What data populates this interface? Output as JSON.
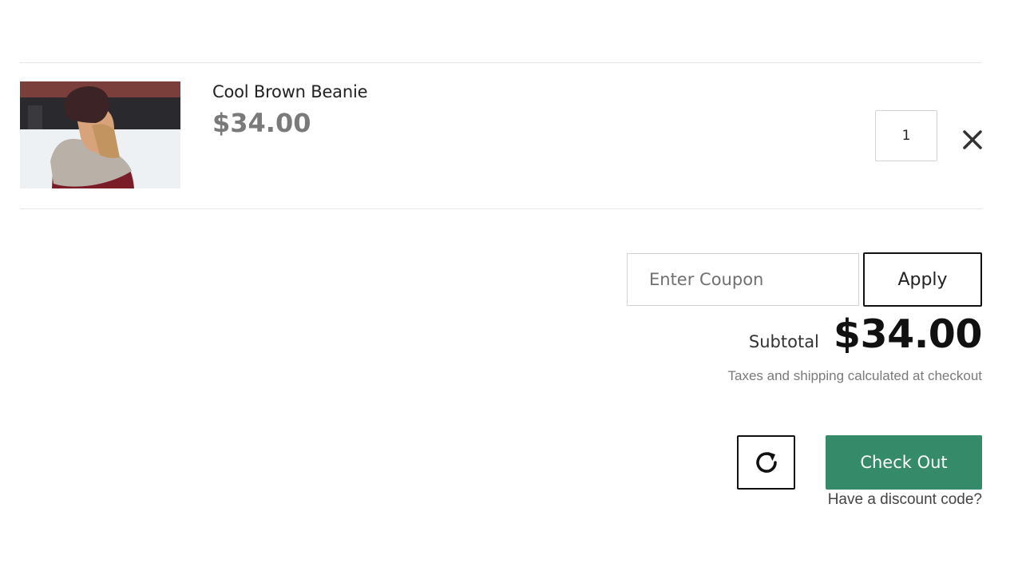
{
  "cart": {
    "items": [
      {
        "name": "Cool Brown Beanie",
        "price": "$34.00",
        "quantity": "1",
        "image_icon": "product-photo-woman-beanie"
      }
    ]
  },
  "coupon": {
    "placeholder": "Enter Coupon",
    "apply_label": "Apply"
  },
  "summary": {
    "subtotal_label": "Subtotal",
    "subtotal_value": "$34.00",
    "tax_note": "Taxes and shipping calculated at checkout"
  },
  "actions": {
    "update_icon": "refresh-icon",
    "checkout_label": "Check Out",
    "discount_link": "Have a discount code?"
  },
  "colors": {
    "checkout_bg": "#358a6a",
    "price_gray": "#7a7a7a",
    "divider": "#e5e5e5"
  }
}
